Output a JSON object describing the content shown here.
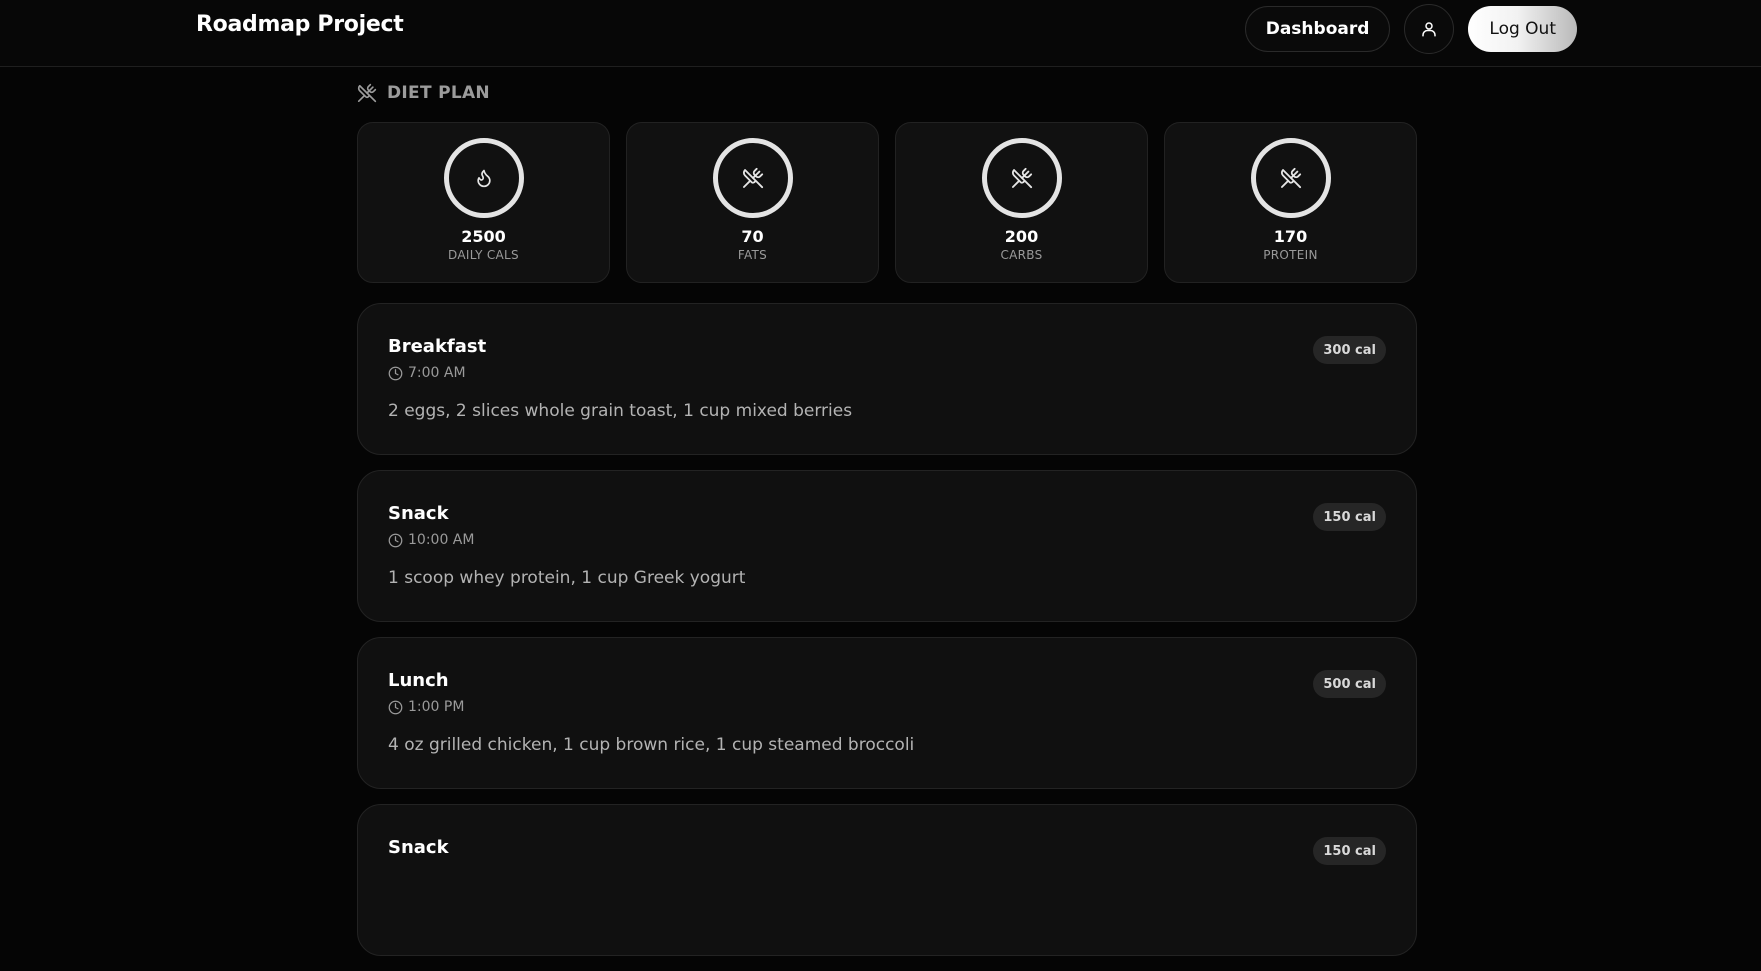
{
  "header": {
    "brand": "Roadmap Project",
    "dashboard_label": "Dashboard",
    "profile_icon": "user-icon",
    "logout_label": "Log Out"
  },
  "section": {
    "title": "DIET PLAN",
    "icon": "utensils-crossed-icon"
  },
  "stats": [
    {
      "value": "2500",
      "label": "DAILY CALS",
      "icon": "flame-icon"
    },
    {
      "value": "70",
      "label": "FATS",
      "icon": "utensils-crossed-icon"
    },
    {
      "value": "200",
      "label": "CARBS",
      "icon": "utensils-crossed-icon"
    },
    {
      "value": "170",
      "label": "PROTEIN",
      "icon": "utensils-crossed-icon"
    }
  ],
  "meals": [
    {
      "name": "Breakfast",
      "time": "7:00 AM",
      "description": "2 eggs, 2 slices whole grain toast, 1 cup mixed berries",
      "calories": "300 cal"
    },
    {
      "name": "Snack",
      "time": "10:00 AM",
      "description": "1 scoop whey protein, 1 cup Greek yogurt",
      "calories": "150 cal"
    },
    {
      "name": "Lunch",
      "time": "1:00 PM",
      "description": "4 oz grilled chicken, 1 cup brown rice, 1 cup steamed broccoli",
      "calories": "500 cal"
    },
    {
      "name": "Snack",
      "time": "",
      "description": "",
      "calories": "150 cal"
    }
  ],
  "colors": {
    "background": "#050505",
    "card": "#111111",
    "ring": "#e4e4e4",
    "badge": "#262626"
  }
}
